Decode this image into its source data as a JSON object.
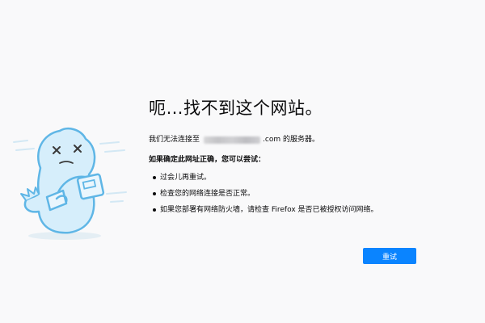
{
  "error_page": {
    "title": "呃…找不到这个网站。",
    "description_prefix": "我们无法连接至",
    "description_domain_suffix": ".com 的服务器。",
    "subheading": "如果确定此网址正确，您可以尝试：",
    "tips": [
      "过会儿再重试。",
      "检查您的网络连接是否正常。",
      "如果您部署有网络防火墙，请检查 Firefox 是否已被授权访问网络。"
    ],
    "retry_label": "重试"
  },
  "colors": {
    "background": "#f9f9fa",
    "accent": "#0a84ff",
    "illustration_stroke": "#5fb6e6",
    "illustration_fill": "#d6eefb"
  }
}
